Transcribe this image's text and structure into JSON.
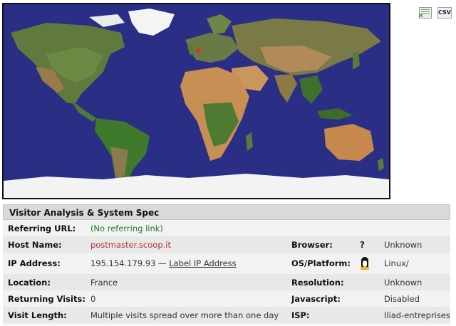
{
  "map": {
    "marker_color": "#ff2020",
    "ocean_color": "#2a2f85"
  },
  "toolbar": {
    "excel_icon": "excel-export-icon",
    "csv_label": "CSV"
  },
  "panel": {
    "title": "Visitor Analysis & System Spec",
    "rows": {
      "referring_url": {
        "label": "Referring URL:",
        "value": "(No referring link)"
      },
      "host_name": {
        "label": "Host Name:",
        "value": "postmaster.scoop.it"
      },
      "browser": {
        "label": "Browser:",
        "icon": "?",
        "value": "Unknown"
      },
      "ip_address": {
        "label": "IP Address:",
        "value": "195.154.179.93",
        "sep": "—",
        "link": "Label IP Address"
      },
      "os": {
        "label": "OS/Platform:",
        "icon": "penguin-icon",
        "value": "Linux/"
      },
      "location": {
        "label": "Location:",
        "value": "France"
      },
      "resolution": {
        "label": "Resolution:",
        "value": "Unknown"
      },
      "returning": {
        "label": "Returning Visits:",
        "value": "0"
      },
      "javascript": {
        "label": "Javascript:",
        "value": "Disabled"
      },
      "visit_length": {
        "label": "Visit Length:",
        "value": "Multiple visits spread over more than one day"
      },
      "isp": {
        "label": "ISP:",
        "value": "Iliad-entreprises"
      }
    }
  }
}
